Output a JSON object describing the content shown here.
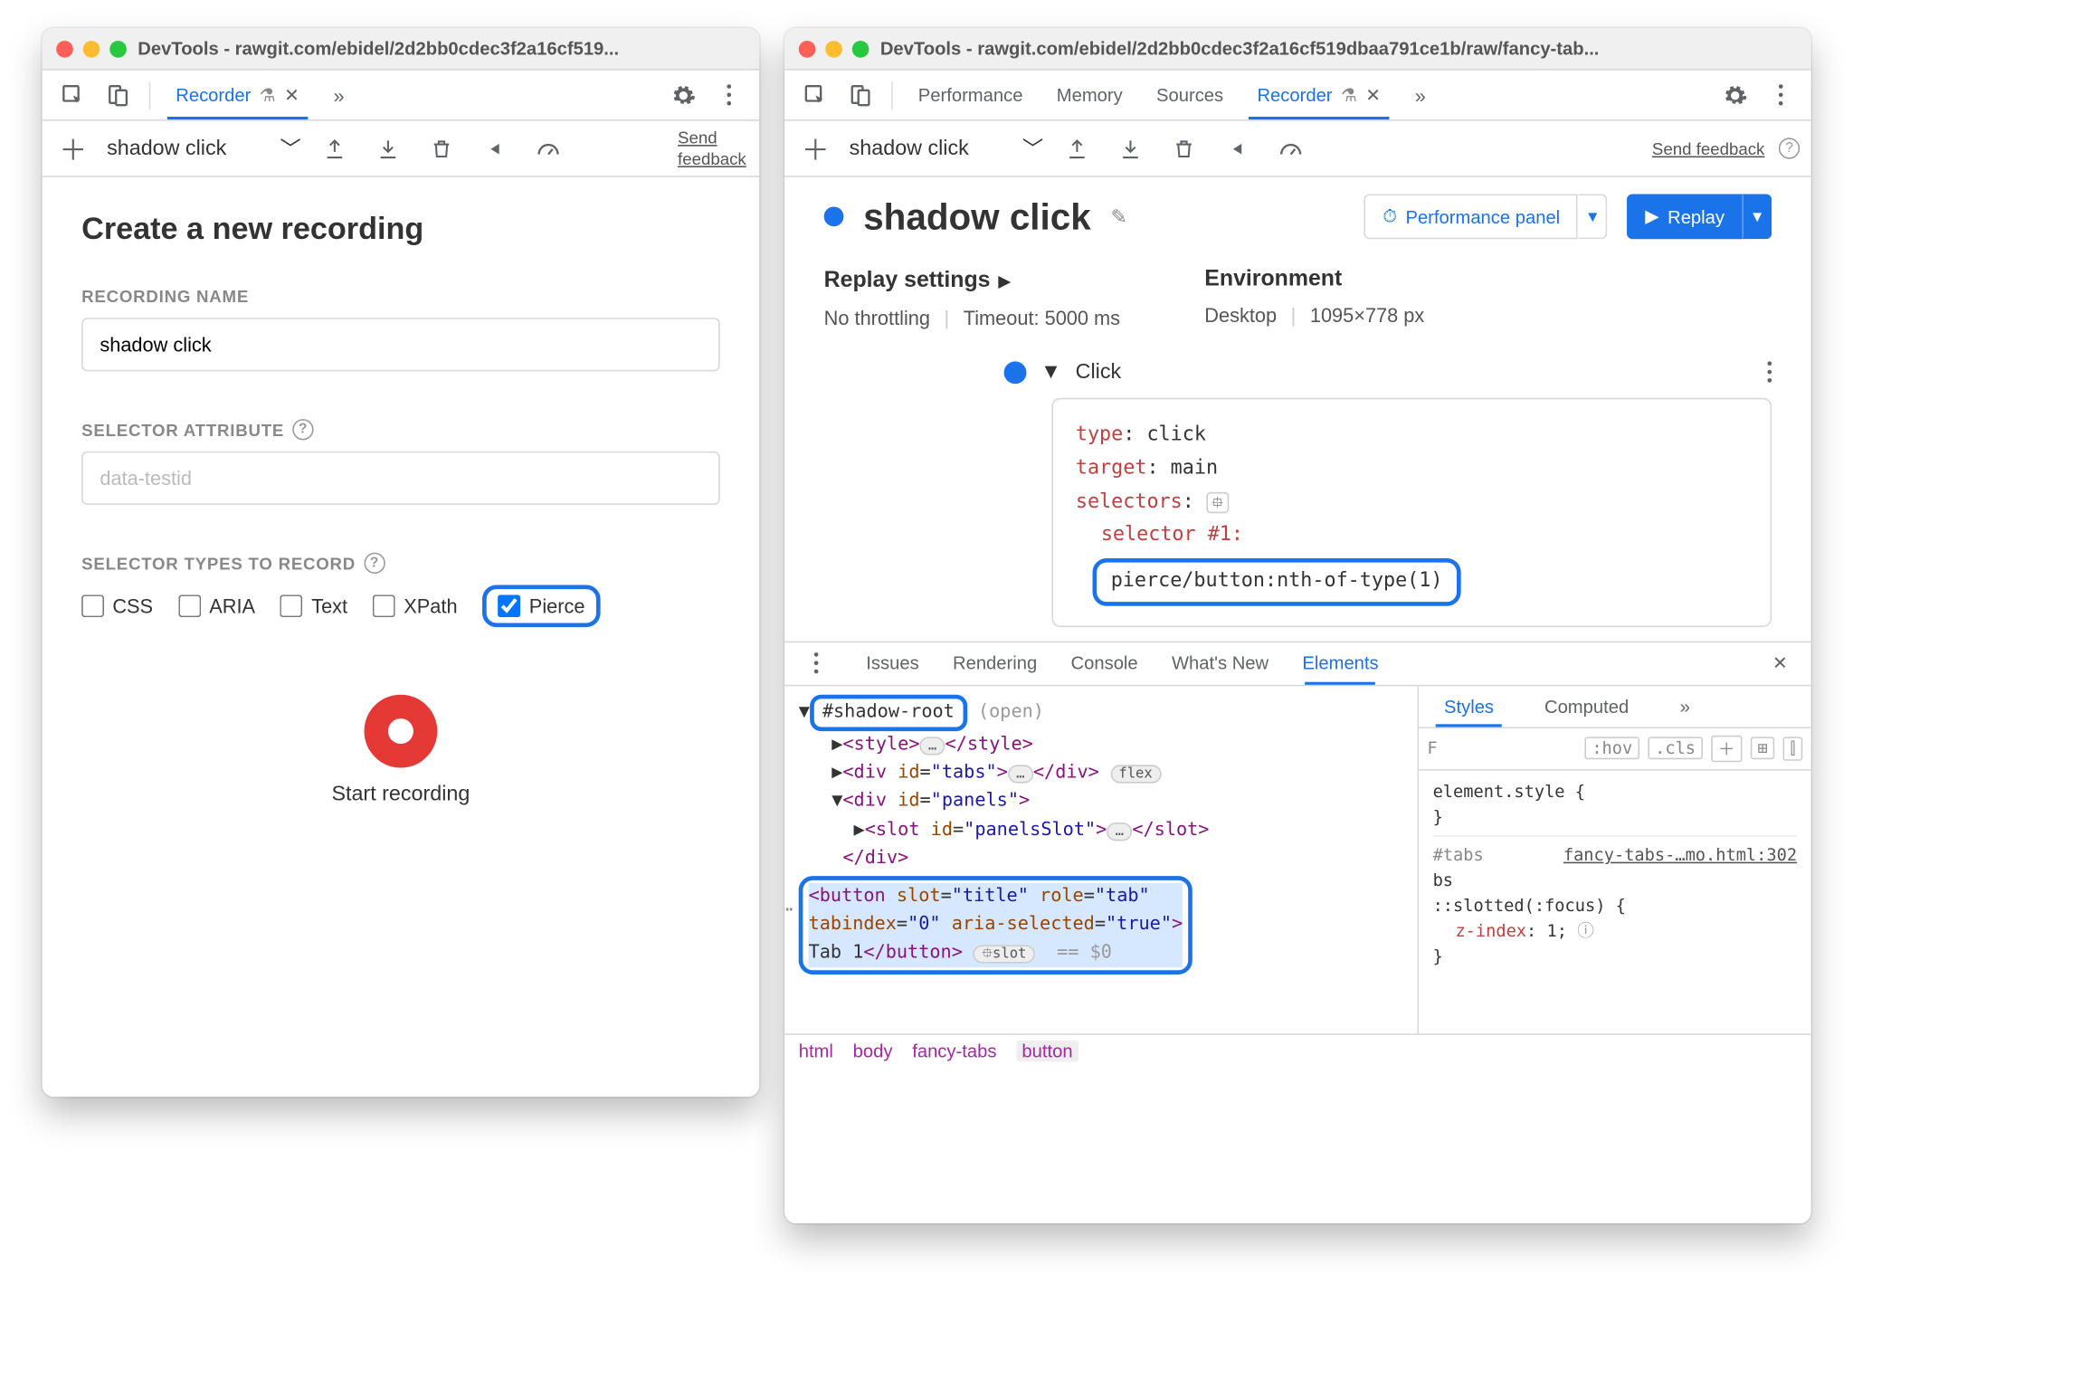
{
  "windows": {
    "left": {
      "title": "DevTools - rawgit.com/ebidel/2d2bb0cdec3f2a16cf519...",
      "active_tab": "Recorder",
      "recording_bar": {
        "name": "shadow click",
        "send_feedback": "Send feedback"
      },
      "form": {
        "heading": "Create a new recording",
        "name_label": "RECORDING NAME",
        "name_value": "shadow click",
        "attr_label": "SELECTOR ATTRIBUTE",
        "attr_placeholder": "data-testid",
        "types_label": "SELECTOR TYPES TO RECORD",
        "types": [
          {
            "label": "CSS",
            "checked": false
          },
          {
            "label": "ARIA",
            "checked": false
          },
          {
            "label": "Text",
            "checked": false
          },
          {
            "label": "XPath",
            "checked": false
          },
          {
            "label": "Pierce",
            "checked": true
          }
        ],
        "start_label": "Start recording"
      }
    },
    "right": {
      "title": "DevTools - rawgit.com/ebidel/2d2bb0cdec3f2a16cf519dbaa791ce1b/raw/fancy-tab...",
      "tabs": [
        "Performance",
        "Memory",
        "Sources",
        "Recorder"
      ],
      "active_tab": "Recorder",
      "recording_bar": {
        "name": "shadow click",
        "send_feedback": "Send feedback"
      },
      "header": {
        "title": "shadow click",
        "perf_btn": "Performance panel",
        "replay_btn": "Replay"
      },
      "settings": {
        "replay_label": "Replay settings",
        "throttling": "No throttling",
        "timeout": "Timeout: 5000 ms",
        "env_label": "Environment",
        "env_device": "Desktop",
        "env_size": "1095×778 px"
      },
      "step": {
        "name": "Click",
        "props": [
          {
            "k": "type",
            "v": "click"
          },
          {
            "k": "target",
            "v": "main"
          },
          {
            "k": "selectors",
            "v": ""
          }
        ],
        "selector_label": "selector #1:",
        "selector_value": "pierce/button:nth-of-type(1)"
      },
      "drawer": {
        "tabs": [
          "Issues",
          "Rendering",
          "Console",
          "What's New",
          "Elements"
        ],
        "active": "Elements",
        "shadow_root": "#shadow-root",
        "shadow_open": "(open)",
        "dom": [
          "  ▶<style>…</style>",
          "  ▶<div id=\"tabs\">…</div> flex",
          "  ▼<div id=\"panels\">",
          "    ▶<slot id=\"panelsSlot\">…</slot>",
          "   </div>"
        ],
        "sel_lines": [
          "<button slot=\"title\" role=\"tab\"",
          "tabindex=\"0\" aria-selected=\"true\">",
          "Tab 1</button>  slot  == $0"
        ],
        "crumbs": [
          "html",
          "body",
          "fancy-tabs",
          "button"
        ],
        "styles": {
          "tabs": [
            "Styles",
            "Computed"
          ],
          "filter_placeholder": "F",
          "hov": ":hov",
          "cls": ".cls",
          "block1_sel": "element.style {",
          "block1_close": "}",
          "src": "fancy-tabs-…mo.html:302",
          "block2_sel": "#tabs",
          "block2_rule": "::slotted(:focus) {",
          "block2_prop": "z-index",
          "block2_val": "1;",
          "block2_close": "}"
        }
      }
    }
  }
}
